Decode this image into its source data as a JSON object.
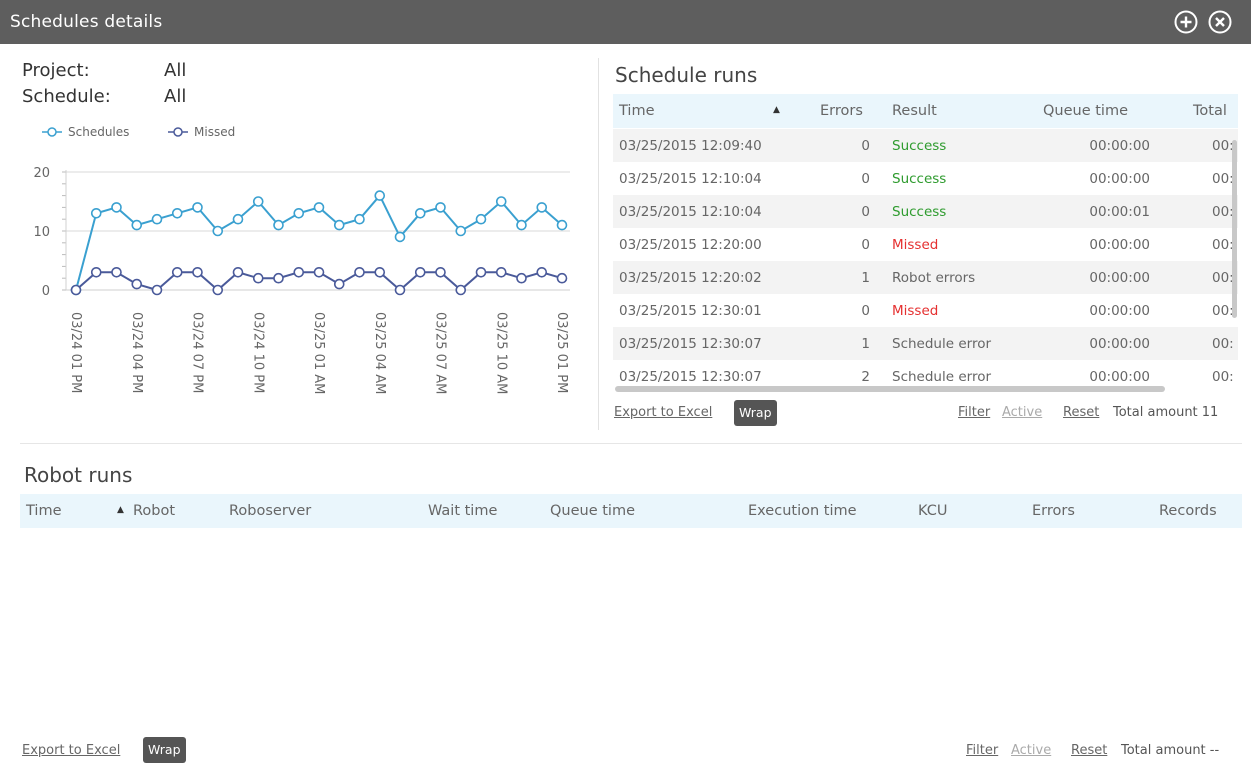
{
  "header": {
    "title": "Schedules details",
    "add_icon": "plus-circle-icon",
    "close_icon": "close-circle-icon"
  },
  "filters": {
    "project_label": "Project:",
    "project_value": "All",
    "schedule_label": "Schedule:",
    "schedule_value": "All"
  },
  "chart_data": {
    "type": "line",
    "xlabel": "",
    "ylabel": "",
    "ylim": [
      0,
      20
    ],
    "yticks": [
      0,
      10,
      20
    ],
    "legend_position": "top-left",
    "xtick_labels": [
      "03/24 01 PM",
      "03/24 04 PM",
      "03/24 07 PM",
      "03/24 10 PM",
      "03/25 01 AM",
      "03/25 04 AM",
      "03/25 07 AM",
      "03/25 10 AM",
      "03/25 01 PM"
    ],
    "series": [
      {
        "name": "Schedules",
        "color": "#3aa0d0",
        "values": [
          0,
          13,
          14,
          11,
          12,
          13,
          14,
          10,
          12,
          15,
          11,
          13,
          14,
          11,
          12,
          16,
          9,
          13,
          14,
          10,
          12,
          15,
          11,
          14,
          11
        ]
      },
      {
        "name": "Missed",
        "color": "#4a5a9a",
        "values": [
          0,
          3,
          3,
          1,
          0,
          3,
          3,
          0,
          3,
          2,
          2,
          3,
          3,
          1,
          3,
          3,
          0,
          3,
          3,
          0,
          3,
          3,
          2,
          3,
          2
        ]
      }
    ]
  },
  "schedule_runs": {
    "title": "Schedule runs",
    "columns": {
      "time": "Time",
      "sort_icon": "▲",
      "errors": "Errors",
      "result": "Result",
      "queue": "Queue time",
      "total": "Total"
    },
    "rows": [
      {
        "time": "03/25/2015 12:09:40",
        "errors": "0",
        "result": "Success",
        "status": "ok",
        "queue": "00:00:00",
        "total": "00:"
      },
      {
        "time": "03/25/2015 12:10:04",
        "errors": "0",
        "result": "Success",
        "status": "ok",
        "queue": "00:00:00",
        "total": "00:"
      },
      {
        "time": "03/25/2015 12:10:04",
        "errors": "0",
        "result": "Success",
        "status": "ok",
        "queue": "00:00:01",
        "total": "00:"
      },
      {
        "time": "03/25/2015 12:20:00",
        "errors": "0",
        "result": "Missed",
        "status": "bad",
        "queue": "00:00:00",
        "total": "00:"
      },
      {
        "time": "03/25/2015 12:20:02",
        "errors": "1",
        "result": "Robot errors",
        "status": "neutral",
        "queue": "00:00:00",
        "total": "00:"
      },
      {
        "time": "03/25/2015 12:30:01",
        "errors": "0",
        "result": "Missed",
        "status": "bad",
        "queue": "00:00:00",
        "total": "00:"
      },
      {
        "time": "03/25/2015 12:30:07",
        "errors": "1",
        "result": "Schedule error",
        "status": "neutral",
        "queue": "00:00:00",
        "total": "00:"
      },
      {
        "time": "03/25/2015 12:30:07",
        "errors": "2",
        "result": "Schedule error",
        "status": "neutral",
        "queue": "00:00:00",
        "total": "00:"
      }
    ],
    "footer": {
      "export": "Export to Excel",
      "wrap": "Wrap",
      "filter": "Filter",
      "active": "Active",
      "reset": "Reset",
      "total": "Total amount 11"
    }
  },
  "robot_runs": {
    "title": "Robot runs",
    "columns": {
      "time": "Time",
      "sort_icon": "▲",
      "robot": "Robot",
      "roboserver": "Roboserver",
      "wait": "Wait time",
      "queue": "Queue time",
      "exec": "Execution time",
      "kcu": "KCU",
      "errors": "Errors",
      "records": "Records"
    },
    "footer": {
      "export": "Export to Excel",
      "wrap": "Wrap",
      "filter": "Filter",
      "active": "Active",
      "reset": "Reset",
      "total": "Total amount --"
    }
  }
}
